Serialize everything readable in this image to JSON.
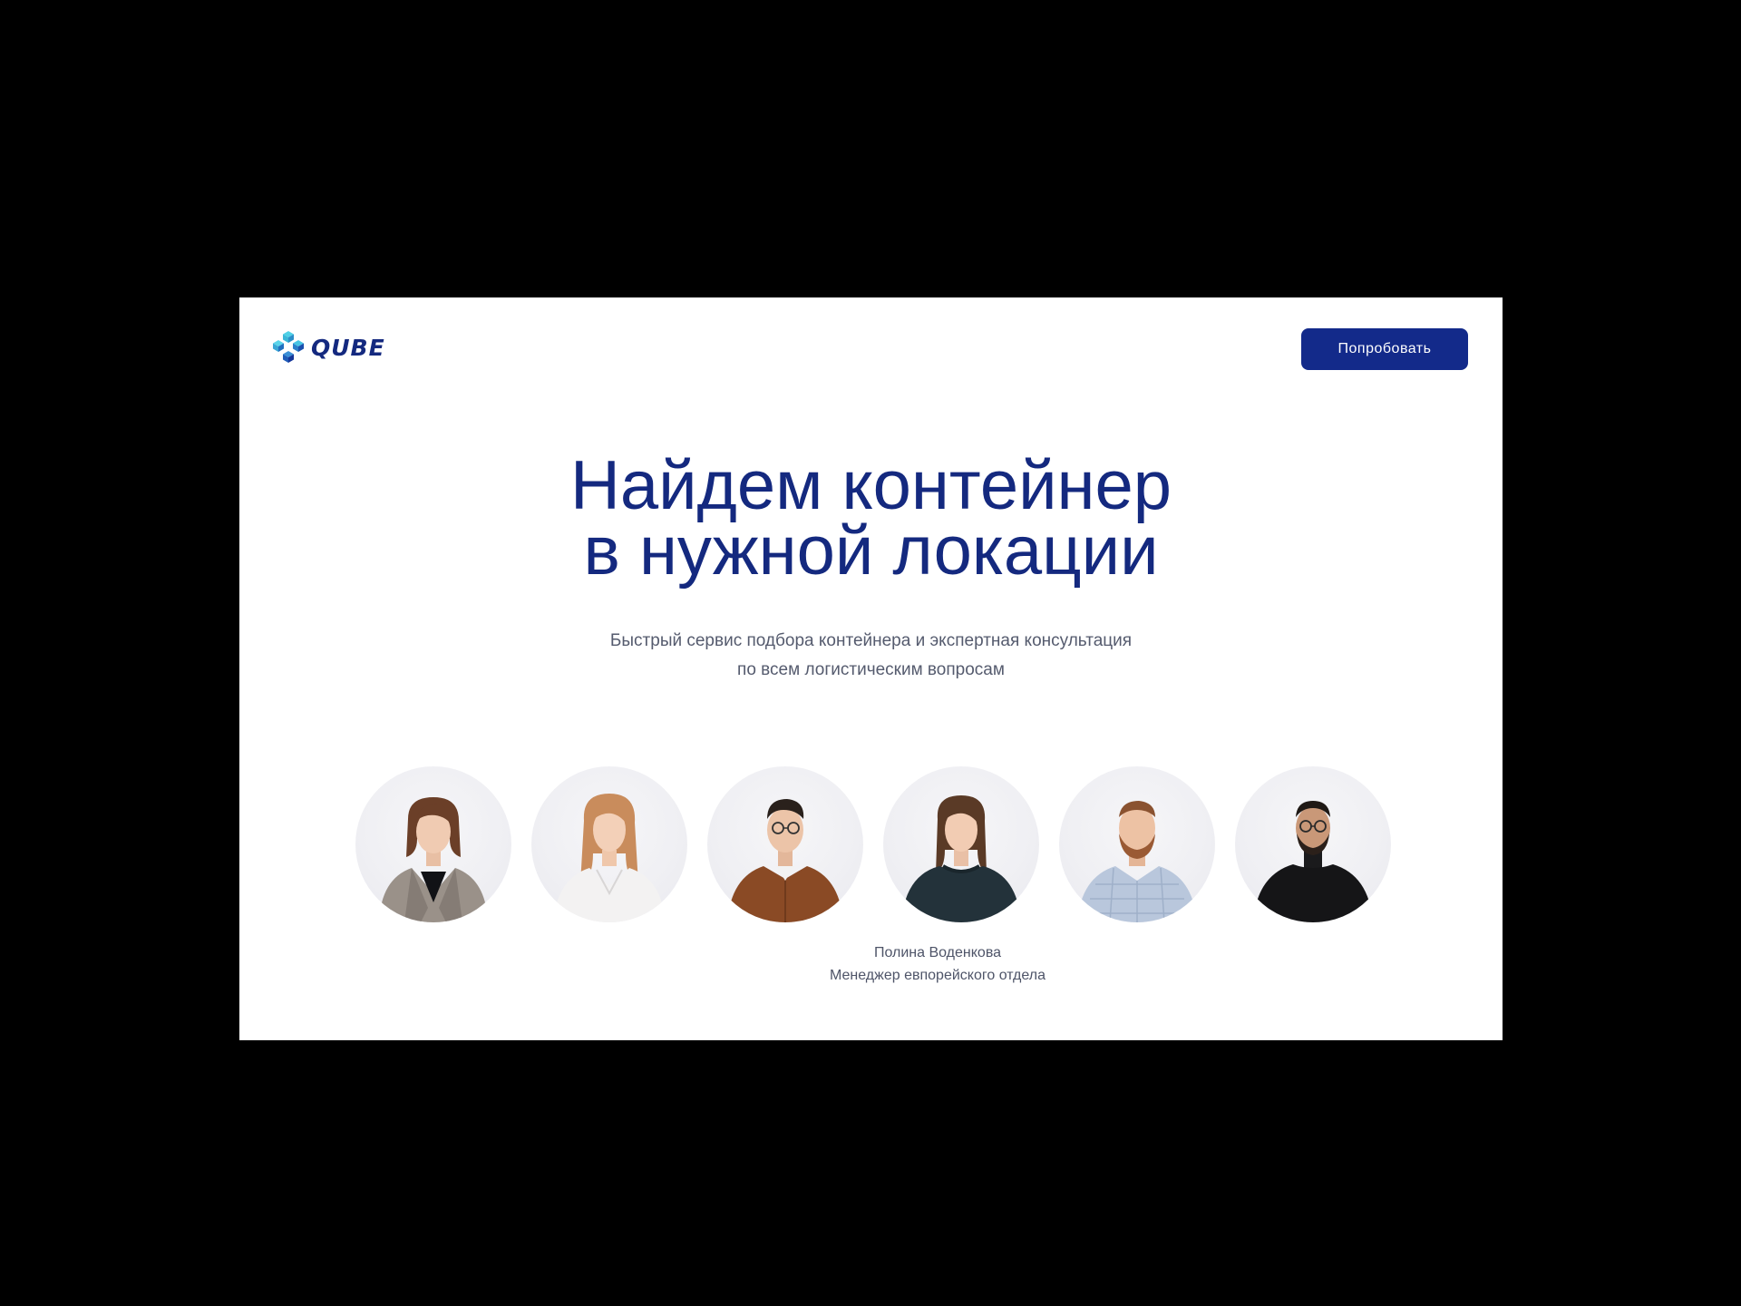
{
  "brand": {
    "logo_text": "QUBE",
    "logo_icon": "hexagon-cubes-logo-icon"
  },
  "header": {
    "cta_label": "Попробовать"
  },
  "hero": {
    "title_line1": "Найдем контейнер",
    "title_line2": "в нужной локации",
    "subtitle_line1": "Быстрый сервис подбора контейнера и экспертная консультация",
    "subtitle_line2": "по всем логистическим вопросам"
  },
  "team": {
    "members": [
      {
        "photo": "woman-grey-blazer-avatar"
      },
      {
        "photo": "woman-white-blouse-avatar"
      },
      {
        "photo": "man-brown-shirt-glasses-avatar"
      },
      {
        "photo": "woman-dark-sweater-avatar"
      },
      {
        "photo": "man-checked-shirt-beard-avatar"
      },
      {
        "photo": "man-black-turtleneck-avatar"
      }
    ],
    "highlighted": {
      "name": "Полина Воденкова",
      "role": "Менеджер евпорейского отдела"
    }
  },
  "colors": {
    "background": "#000000",
    "page": "#ffffff",
    "brand_blue": "#14297f",
    "button_blue": "#132a8a",
    "logo_cyan": "#3fc6e0",
    "text_grey": "#555b6e"
  }
}
